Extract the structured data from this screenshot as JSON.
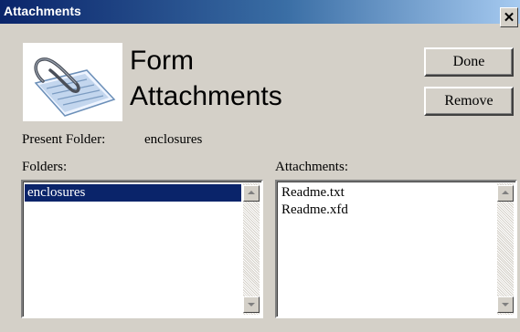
{
  "window": {
    "title": "Attachments",
    "close_glyph": "✕"
  },
  "header": {
    "logo_icon": "paperclip-document-icon",
    "heading_line1": "Form",
    "heading_line2": "Attachments"
  },
  "buttons": {
    "done_label": "Done",
    "remove_label": "Remove"
  },
  "present_folder": {
    "label": "Present Folder:",
    "value": "enclosures"
  },
  "folders": {
    "label": "Folders:",
    "items": [
      {
        "name": "enclosures",
        "selected": true
      }
    ]
  },
  "attachments": {
    "label": "Attachments:",
    "items": [
      {
        "name": "Readme.txt"
      },
      {
        "name": "Readme.xfd"
      }
    ]
  },
  "colors": {
    "titlebar_start": "#0a246a",
    "titlebar_end": "#a6caf0",
    "dialog_bg": "#d4d0c8",
    "selection_bg": "#0a246a"
  }
}
